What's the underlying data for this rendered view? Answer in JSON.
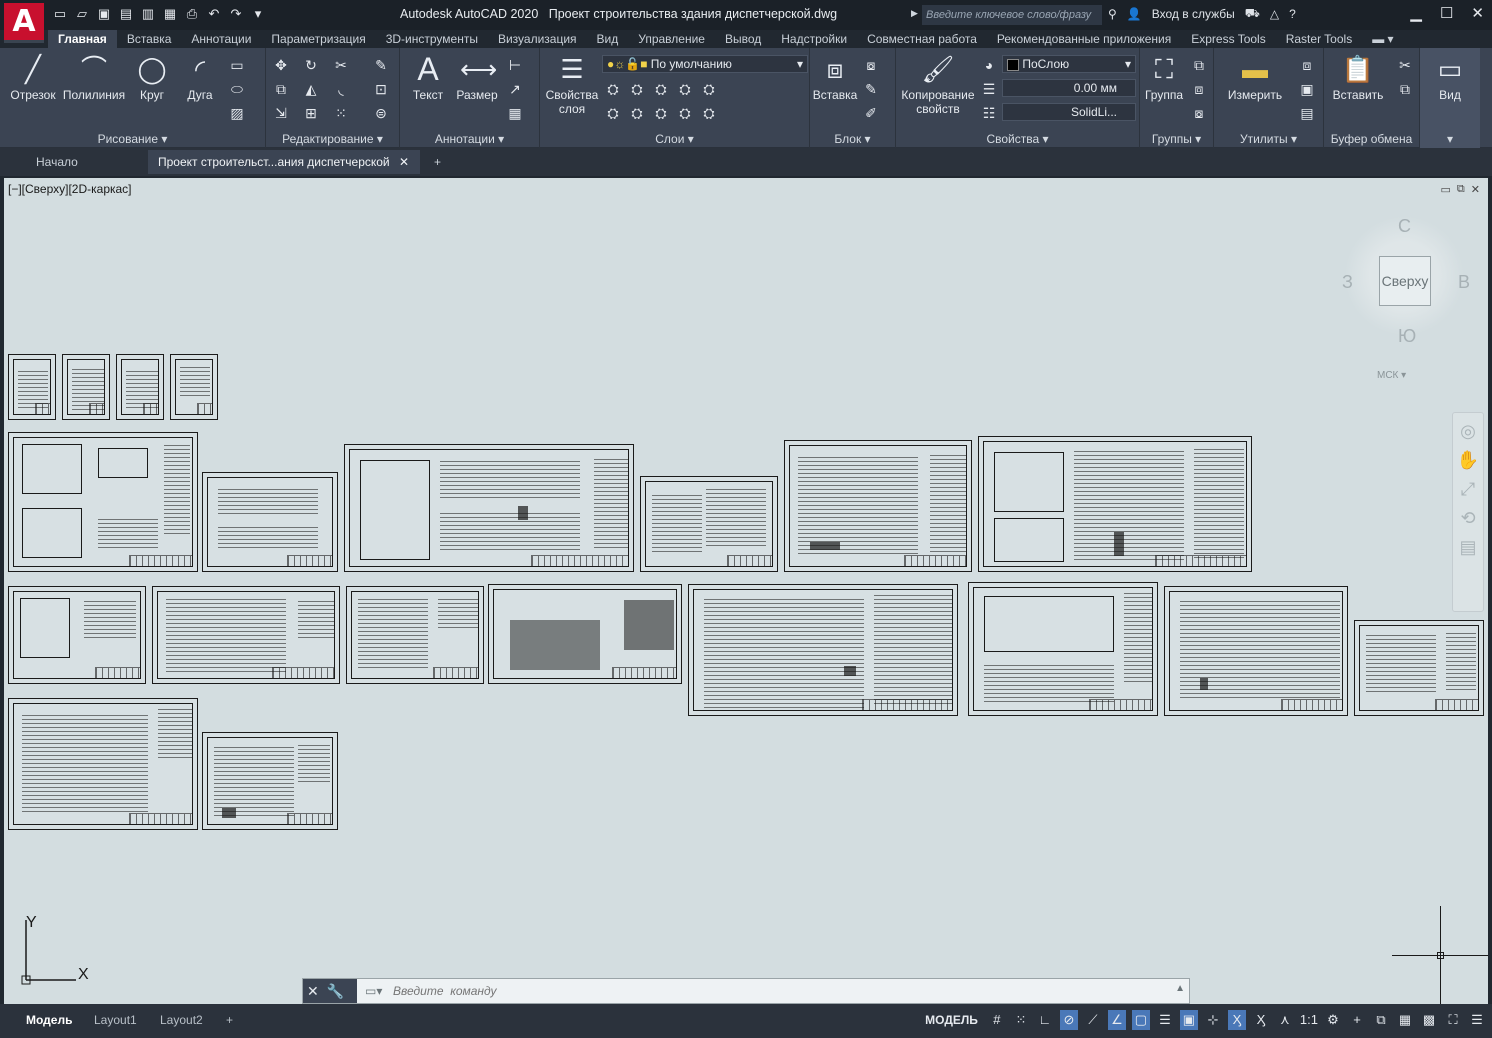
{
  "app": {
    "title": "Autodesk AutoCAD 2020",
    "filename": "Проект строительства здания диспетчерской.dwg",
    "logo_letter": "A"
  },
  "search": {
    "placeholder": "Введите ключевое слово/фразу"
  },
  "titlebar_right": {
    "signin": "Вход в службы"
  },
  "menu_tabs": [
    "Главная",
    "Вставка",
    "Аннотации",
    "Параметризация",
    "3D-инструменты",
    "Визуализация",
    "Вид",
    "Управление",
    "Вывод",
    "Надстройки",
    "Совместная работа",
    "Рекомендованные приложения",
    "Express Tools",
    "Raster Tools"
  ],
  "ribbon": {
    "draw": {
      "title": "Рисование",
      "line": "Отрезок",
      "polyline": "Полилиния",
      "circle": "Круг",
      "arc": "Дуга"
    },
    "modify": {
      "title": "Редактирование"
    },
    "annotation": {
      "title": "Аннотации",
      "text": "Текст",
      "dimension": "Размер"
    },
    "layers": {
      "title": "Слои",
      "props": "Свойства слоя",
      "props_l1": "Свойства",
      "props_l2": "слоя",
      "current": "По умолчанию"
    },
    "block": {
      "title": "Блок",
      "insert": "Вставка"
    },
    "properties": {
      "title": "Свойства",
      "copy_l1": "Копирование",
      "copy_l2": "свойств",
      "color": "ПоСлою",
      "lineweight": "0.00 мм",
      "linetype": "SolidLi..."
    },
    "groups": {
      "title": "Группы",
      "group": "Группа"
    },
    "utilities": {
      "title": "Утилиты",
      "measure": "Измерить"
    },
    "clipboard": {
      "title": "Буфер обмена",
      "paste": "Вставить"
    },
    "view": {
      "title": "Вид"
    }
  },
  "doc_tabs": {
    "start": "Начало",
    "active": "Проект строительст...ания диспетчерской"
  },
  "viewport": {
    "label": "[−][Сверху][2D-каркас]"
  },
  "viewcube": {
    "top": "Сверху",
    "north": "С",
    "south": "Ю",
    "west": "З",
    "east": "В",
    "ucs": "МСК"
  },
  "ucs_axes": {
    "x": "X",
    "y": "Y"
  },
  "command": {
    "placeholder": "Введите  команду"
  },
  "layout_tabs": [
    "Модель",
    "Layout1",
    "Layout2"
  ],
  "status": {
    "model": "МОДЕЛЬ",
    "scale": "1:1"
  }
}
